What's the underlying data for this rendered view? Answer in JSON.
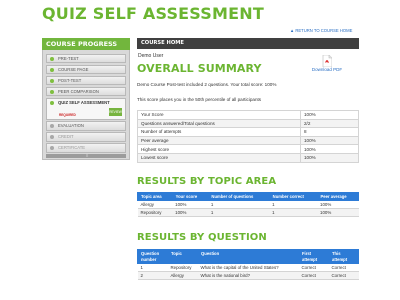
{
  "page": {
    "title": "QUIZ SELF ASSESSMENT"
  },
  "return_link": "RETURN TO COURSE HOME",
  "sidebar": {
    "title": "COURSE PROGRESS",
    "items": [
      {
        "label": "PRE-TEST"
      },
      {
        "label": "COURSE PAGE"
      },
      {
        "label": "POST-TEST"
      },
      {
        "label": "PEER COMPARISON"
      },
      {
        "label": "QUIZ SELF ASSESSMENT",
        "status": "REQUIRED",
        "button": "REVIEW"
      },
      {
        "label": "EVALUATION"
      },
      {
        "label": "CREDIT"
      },
      {
        "label": "CERTIFICATE"
      }
    ]
  },
  "course_home": {
    "title": "COURSE HOME",
    "user": "Demo User"
  },
  "summary": {
    "title": "OVERALL SUMMARY",
    "download_label": "Download PDF",
    "text1": "Demo Course Post-test included 2 questions. Your total score: 100%",
    "text2": "This score places you in the 50th percentile of all participants",
    "rows": [
      {
        "label": "Your Score",
        "value": "100%"
      },
      {
        "label": "Questions answered/Total questions",
        "value": "2/2"
      },
      {
        "label": "Number of attempts",
        "value": "8"
      },
      {
        "label": "Peer average",
        "value": "100%"
      },
      {
        "label": "Highest score",
        "value": "100%"
      },
      {
        "label": "Lowest score",
        "value": "100%"
      }
    ]
  },
  "topics": {
    "title": "RESULTS BY TOPIC AREA",
    "headers": [
      "Topic area",
      "Your score",
      "Number of questions",
      "Number correct",
      "Peer average"
    ],
    "rows": [
      [
        "Allergy",
        "100%",
        "1",
        "1",
        "100%"
      ],
      [
        "Repository",
        "100%",
        "1",
        "1",
        "100%"
      ]
    ]
  },
  "questions": {
    "title": "RESULTS BY QUESTION",
    "headers": [
      "Question number",
      "Topic",
      "Question",
      "First attempt",
      "This attempt"
    ],
    "rows": [
      [
        "1",
        "Repository",
        "What is the capital of the United States?",
        "Correct",
        "Correct"
      ],
      [
        "2",
        "Allergy",
        "What is the national bird?",
        "Correct",
        "Correct"
      ]
    ]
  },
  "colors": {
    "accent_green": "#6bb531",
    "header_blue": "#2d7bd6",
    "dark_bar": "#404040",
    "required_red": "#cc2222"
  },
  "icons": {
    "pdf": "pdf-file-icon",
    "return": "arrow-up-icon"
  }
}
